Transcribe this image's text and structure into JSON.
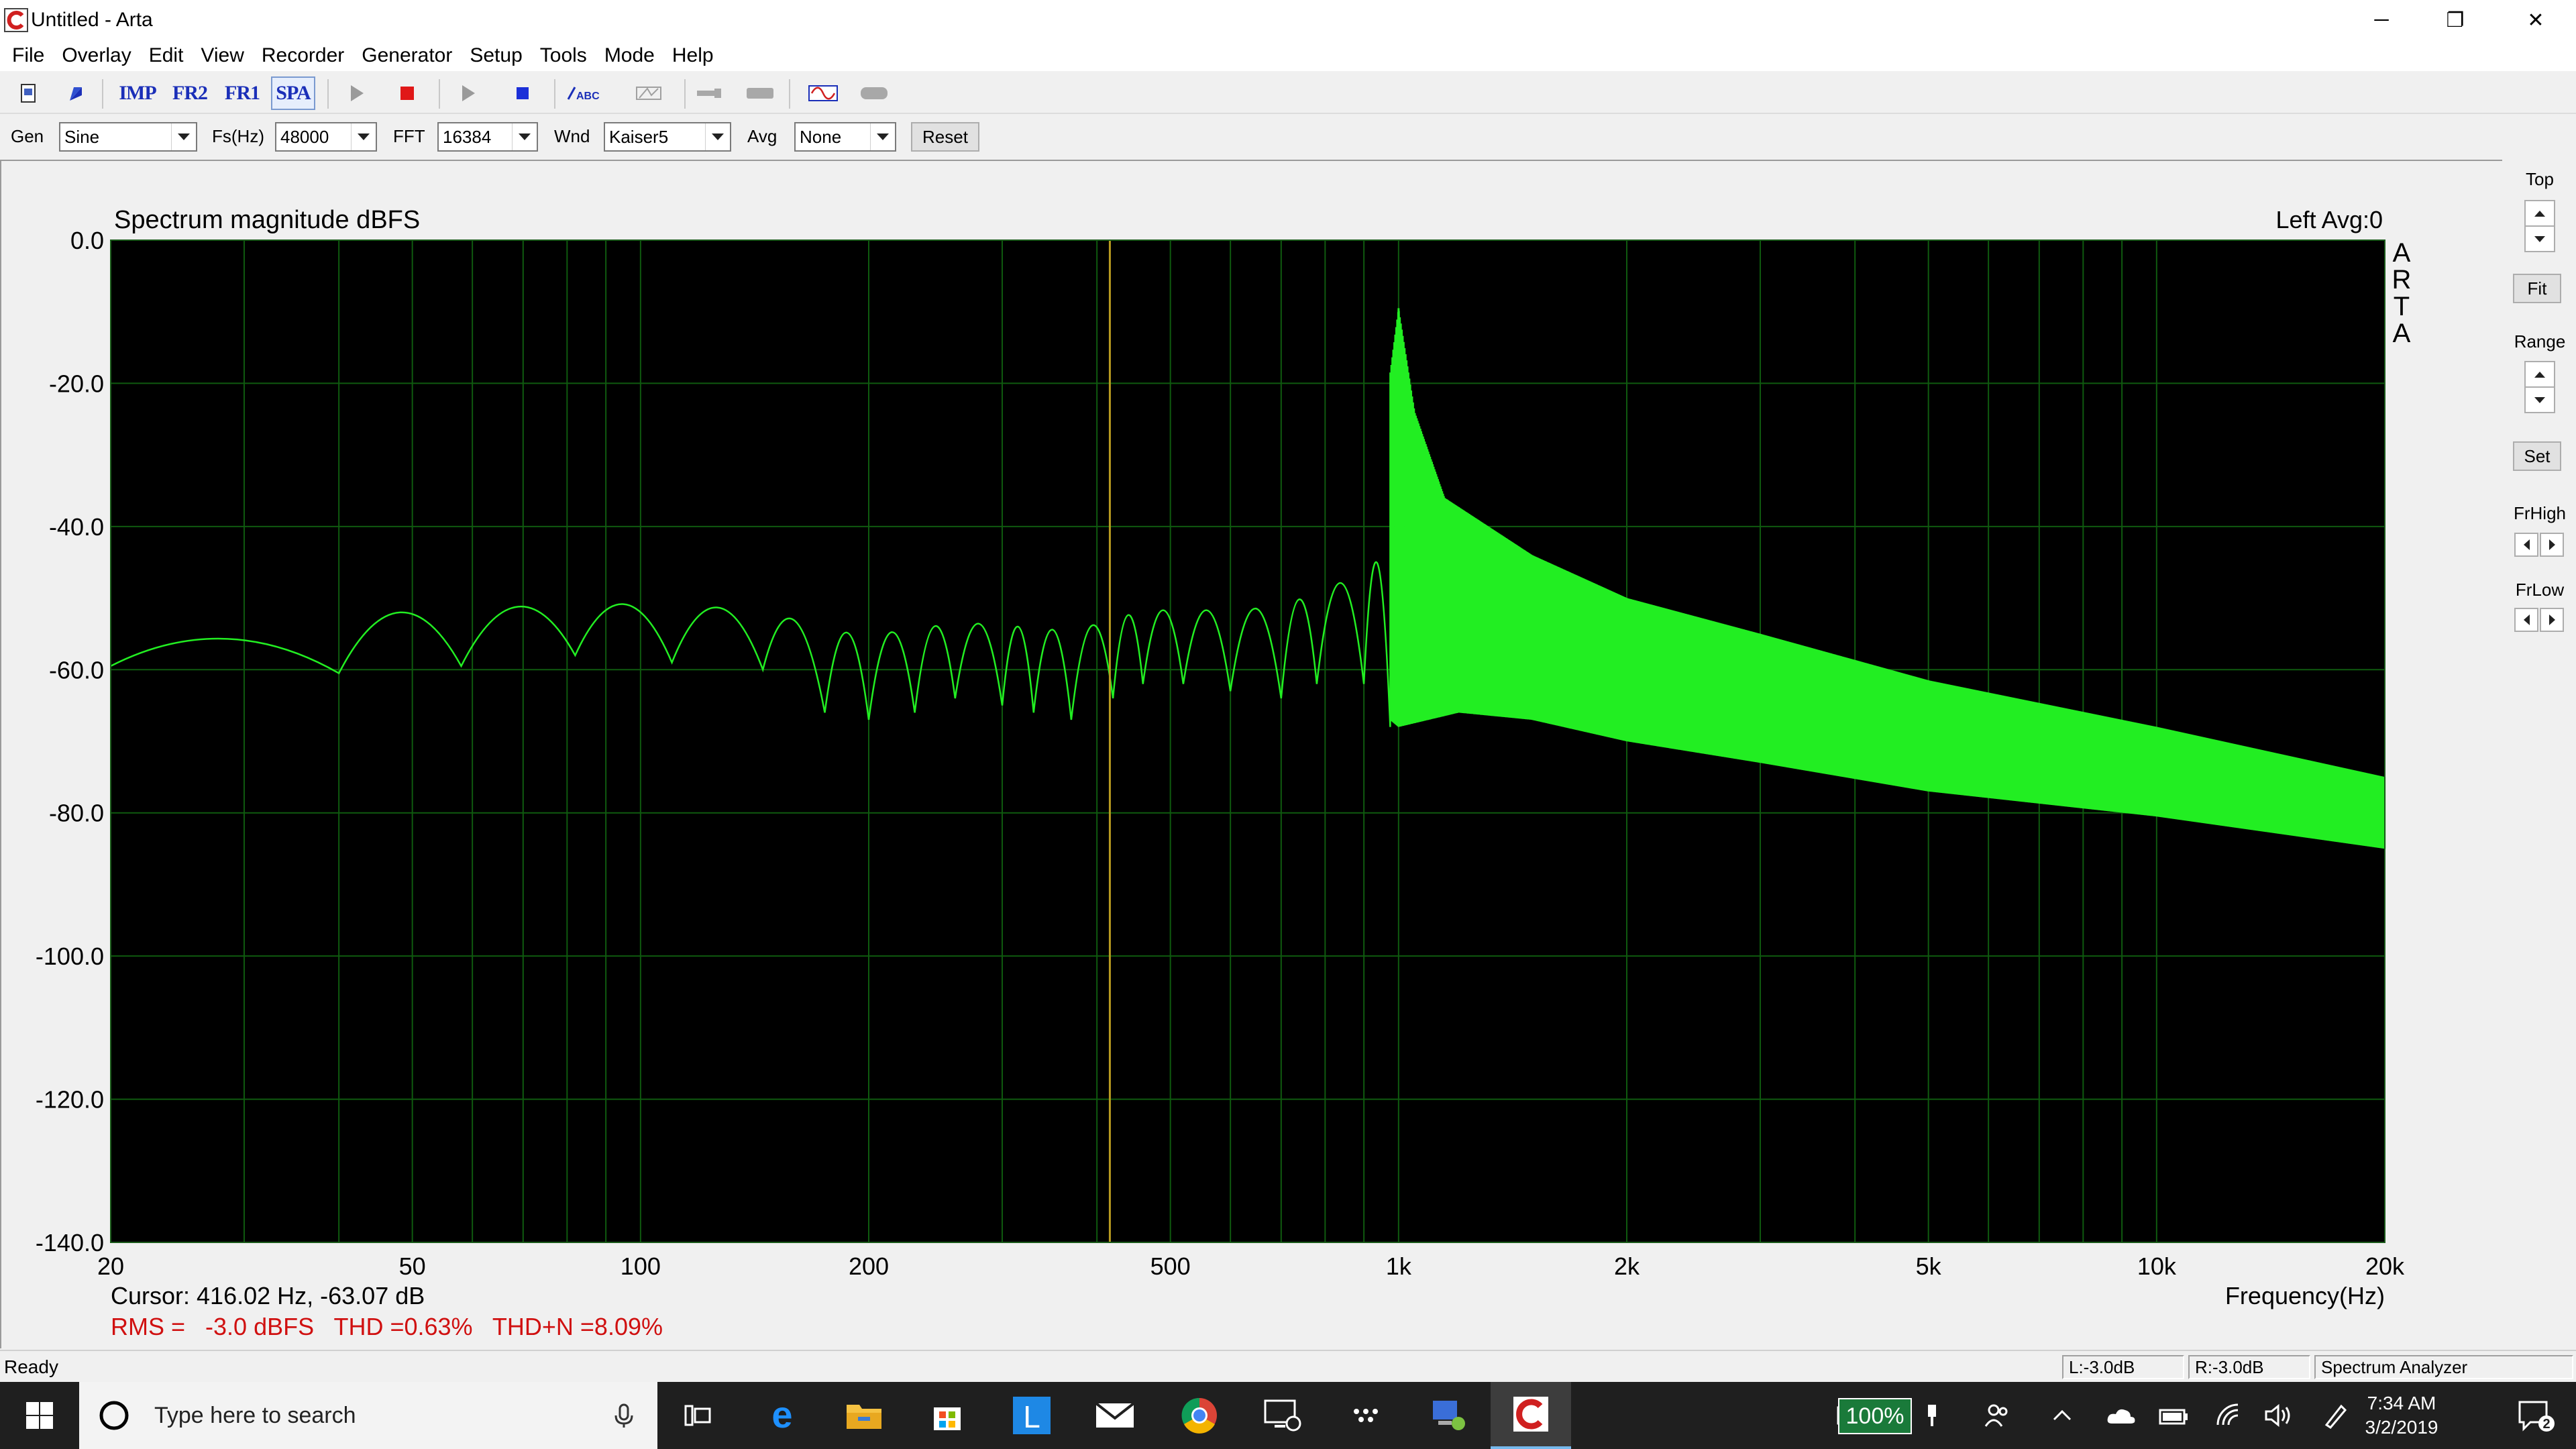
{
  "window": {
    "title": "Untitled - Arta",
    "minimize": "─",
    "restore": "❐",
    "close": "✕"
  },
  "menu": [
    "File",
    "Overlay",
    "Edit",
    "View",
    "Recorder",
    "Generator",
    "Setup",
    "Tools",
    "Mode",
    "Help"
  ],
  "toolbar": {
    "imp": "IMP",
    "fr2": "FR2",
    "fr1": "FR1",
    "spa": "SPA",
    "icons": [
      "new-file-icon",
      "open-icon",
      "play-icon",
      "record-stop-icon",
      "play-icon",
      "stop-icon",
      "abc-icon",
      "signal-icon",
      "probe-icon",
      "bar-icon",
      "waveform-icon",
      "cylinder-icon"
    ]
  },
  "controls": {
    "gen_label": "Gen",
    "gen_value": "Sine",
    "fs_label": "Fs(Hz)",
    "fs_value": "48000",
    "fft_label": "FFT",
    "fft_value": "16384",
    "wnd_label": "Wnd",
    "wnd_value": "Kaiser5",
    "avg_label": "Avg",
    "avg_value": "None",
    "reset": "Reset"
  },
  "right_panel": {
    "top": "Top",
    "fit": "Fit",
    "range": "Range",
    "set": "Set",
    "frhigh": "FrHigh",
    "frlow": "FrLow"
  },
  "graph": {
    "brand": [
      "A",
      "R",
      "T",
      "A"
    ],
    "channel": "Left  Avg:0",
    "cursor_text": "Cursor: 416.02 Hz, -63.07 dB",
    "stats_text": "RMS =   -3.0 dBFS   THD =0.63%   THD+N =8.09%"
  },
  "chart_data": {
    "type": "line",
    "title": "Spectrum magnitude dBFS",
    "xlabel": "Frequency(Hz)",
    "ylabel": "",
    "x_scale": "log",
    "xlim": [
      20,
      20000
    ],
    "ylim": [
      -140,
      0
    ],
    "x_ticks": [
      {
        "v": 20,
        "label": "20"
      },
      {
        "v": 50,
        "label": "50"
      },
      {
        "v": 100,
        "label": "100"
      },
      {
        "v": 200,
        "label": "200"
      },
      {
        "v": 500,
        "label": "500"
      },
      {
        "v": 1000,
        "label": "1k"
      },
      {
        "v": 2000,
        "label": "2k"
      },
      {
        "v": 5000,
        "label": "5k"
      },
      {
        "v": 10000,
        "label": "10k"
      },
      {
        "v": 20000,
        "label": "20k"
      }
    ],
    "x_minor": [
      30,
      40,
      60,
      70,
      80,
      90,
      300,
      400,
      600,
      700,
      800,
      900,
      3000,
      4000,
      6000,
      7000,
      8000,
      9000
    ],
    "y_ticks": [
      {
        "v": 0,
        "label": "0.0"
      },
      {
        "v": -20,
        "label": "-20.0"
      },
      {
        "v": -40,
        "label": "-40.0"
      },
      {
        "v": -60,
        "label": "-60.0"
      },
      {
        "v": -80,
        "label": "-80.0"
      },
      {
        "v": -100,
        "label": "-100.0"
      },
      {
        "v": -120,
        "label": "-120.0"
      },
      {
        "v": -140,
        "label": "-140.0"
      }
    ],
    "grid": true,
    "cursor_hz": 416.02,
    "peak": {
      "hz": 1000,
      "db": -9.5
    },
    "series": [
      {
        "upper_envelope": [
          [
            20,
            -59.5
          ],
          [
            23,
            -58
          ],
          [
            27,
            -55
          ],
          [
            32,
            -48.5
          ],
          [
            38,
            -46
          ],
          [
            43,
            -45.5
          ],
          [
            50,
            -46
          ],
          [
            70,
            -45.5
          ],
          [
            100,
            -45
          ],
          [
            200,
            -45
          ],
          [
            400,
            -44
          ],
          [
            600,
            -42.5
          ],
          [
            800,
            -38
          ],
          [
            900,
            -32
          ],
          [
            960,
            -24
          ],
          [
            1000,
            -9.5
          ],
          [
            1050,
            -24
          ],
          [
            1150,
            -36
          ],
          [
            1500,
            -44
          ],
          [
            2000,
            -50
          ],
          [
            3000,
            -55
          ],
          [
            5000,
            -61.5
          ],
          [
            10000,
            -68
          ],
          [
            20000,
            -75
          ]
        ],
        "lower_envelope": [
          [
            20,
            -60
          ],
          [
            40,
            -60
          ],
          [
            100,
            -62
          ],
          [
            200,
            -65
          ],
          [
            300,
            -66
          ],
          [
            500,
            -64
          ],
          [
            700,
            -63
          ],
          [
            900,
            -64
          ],
          [
            1000,
            -68
          ],
          [
            1200,
            -66
          ],
          [
            1500,
            -67
          ],
          [
            2000,
            -70
          ],
          [
            3000,
            -73
          ],
          [
            5000,
            -77
          ],
          [
            10000,
            -80.5
          ],
          [
            20000,
            -85
          ]
        ],
        "nulls": [
          [
            40,
            -60.5
          ],
          [
            58,
            -59.5
          ],
          [
            82,
            -58
          ],
          [
            110,
            -59
          ],
          [
            145,
            -60
          ],
          [
            175,
            -66
          ],
          [
            200,
            -67
          ],
          [
            230,
            -66
          ],
          [
            260,
            -64
          ],
          [
            300,
            -65
          ],
          [
            330,
            -66
          ],
          [
            370,
            -67
          ],
          [
            420,
            -64
          ],
          [
            460,
            -62
          ],
          [
            520,
            -62
          ],
          [
            600,
            -63
          ],
          [
            700,
            -64
          ],
          [
            780,
            -62
          ],
          [
            900,
            -62
          ],
          [
            975,
            -68
          ]
        ]
      }
    ]
  },
  "status": {
    "ready": "Ready",
    "left": "L:-3.0dB",
    "right": "R:-3.0dB",
    "mode": "Spectrum Analyzer"
  },
  "taskbar": {
    "search_placeholder": "Type here to search",
    "battery": "100%",
    "time": "7:34 AM",
    "date": "3/2/2019",
    "notifications": "2",
    "apps": [
      "task-view-icon",
      "edge-icon",
      "file-explorer-icon",
      "store-icon",
      "l-app-icon",
      "mail-icon",
      "chrome-icon",
      "remote-desktop-icon",
      "dots-app-icon",
      "network-pc-icon",
      "arta-icon"
    ]
  }
}
